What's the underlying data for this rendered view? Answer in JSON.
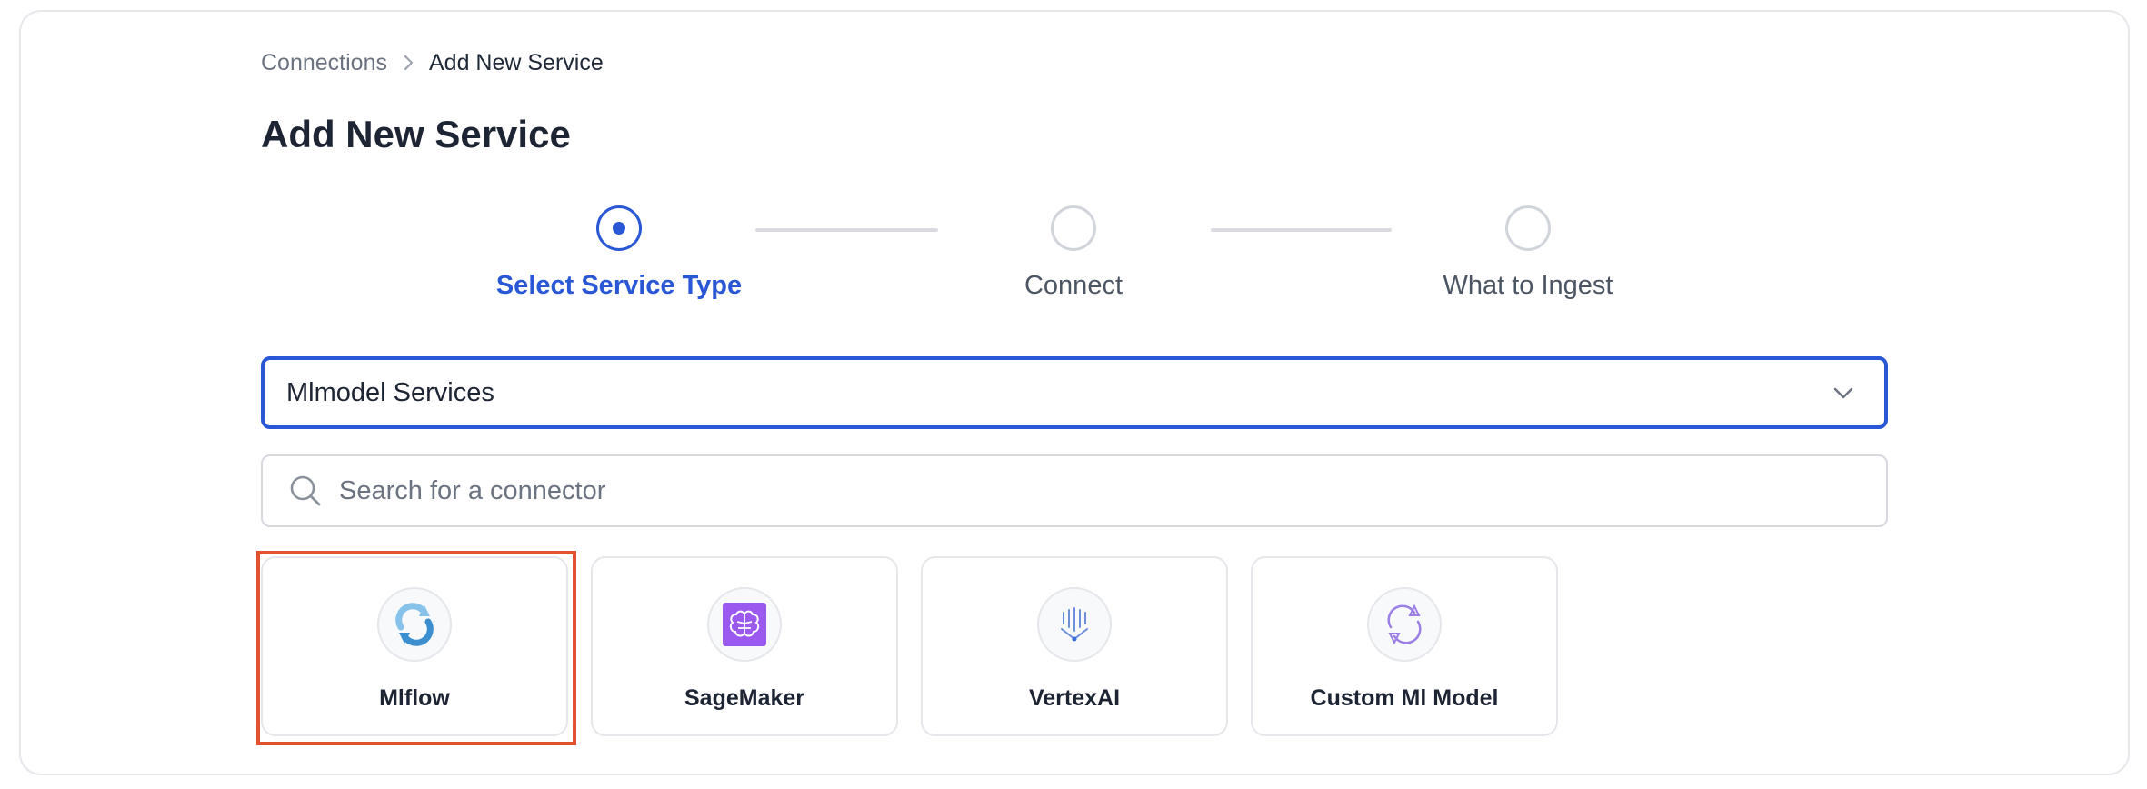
{
  "breadcrumb": {
    "parent": "Connections",
    "current": "Add New Service"
  },
  "page": {
    "title": "Add New Service"
  },
  "stepper": {
    "steps": [
      {
        "label": "Select Service Type",
        "state": "active"
      },
      {
        "label": "Connect",
        "state": "pending"
      },
      {
        "label": "What to Ingest",
        "state": "pending"
      }
    ]
  },
  "service_category": {
    "selected": "Mlmodel Services"
  },
  "search": {
    "placeholder": "Search for a connector",
    "value": ""
  },
  "connectors": [
    {
      "label": "Mlflow",
      "icon": "mlflow-logo-icon",
      "selected": true
    },
    {
      "label": "SageMaker",
      "icon": "sagemaker-logo-icon",
      "selected": false
    },
    {
      "label": "VertexAI",
      "icon": "vertexai-logo-icon",
      "selected": false
    },
    {
      "label": "Custom Ml Model",
      "icon": "custom-ml-model-logo-icon",
      "selected": false
    }
  ],
  "colors": {
    "accent": "#2957d6",
    "highlight": "#e2522e",
    "border": "#e5e7eb",
    "text": "#1d2433",
    "muted": "#6b7280"
  }
}
